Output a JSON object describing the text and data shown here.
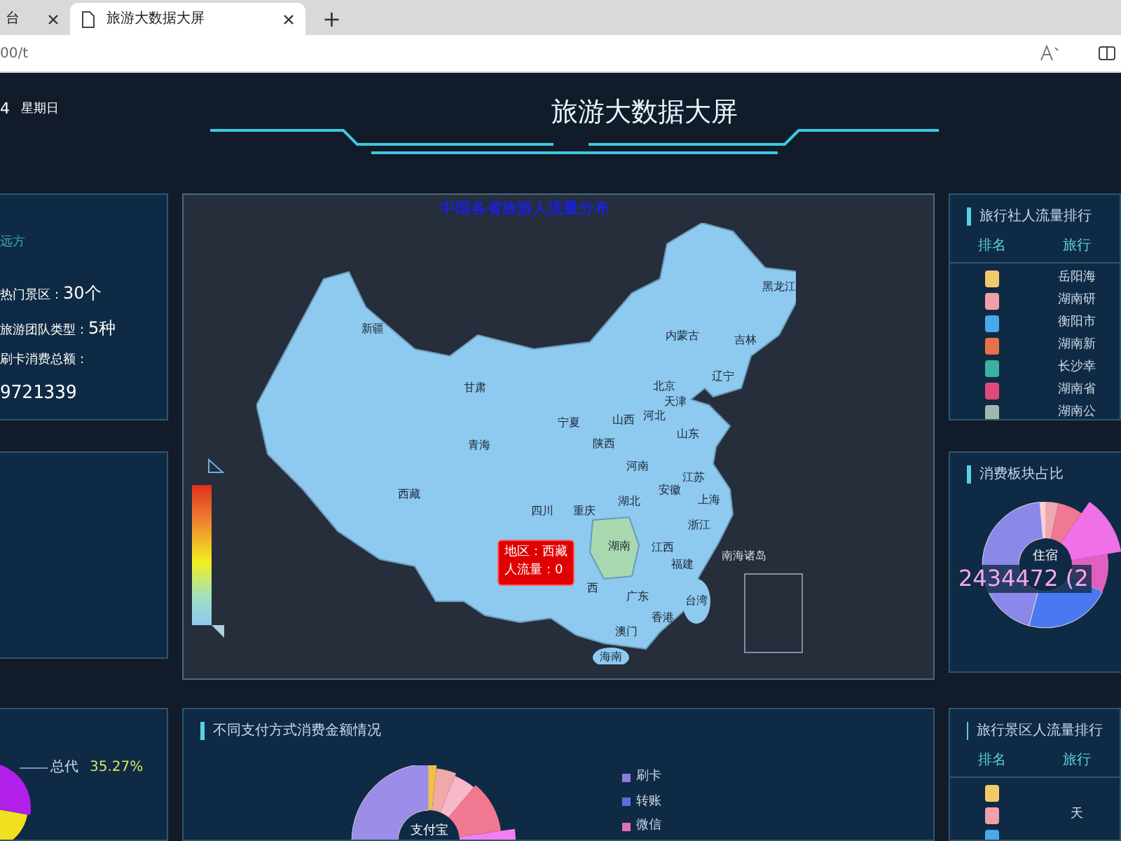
{
  "browser": {
    "tabs": [
      {
        "title": "台",
        "selected": false
      },
      {
        "title": "旅游大数据大屏",
        "selected": true
      }
    ],
    "new_tab": "+",
    "address": "00/t"
  },
  "header": {
    "date": "4",
    "weekday": "星期日",
    "title": "旅游大数据大屏"
  },
  "summary": {
    "heading": "远方",
    "stats": [
      {
        "label": "热门景区：",
        "value": "30个"
      },
      {
        "label": "旅游团队类型：",
        "value": "5种"
      }
    ],
    "total_label": "刷卡消费总额：",
    "total_value": "9721339"
  },
  "age_chart": {
    "label": "总代",
    "percent": "35.27%"
  },
  "map": {
    "title": "中国各省旅游人流量分布",
    "regions": [
      "新疆",
      "甘肃",
      "内蒙古",
      "黑龙江",
      "吉林",
      "辽宁",
      "北京",
      "天津",
      "河北",
      "宁夏",
      "山西",
      "青海",
      "陕西",
      "山东",
      "河南",
      "江苏",
      "安徽",
      "湖北",
      "西藏",
      "四川",
      "重庆",
      "上海",
      "浙江",
      "湖南",
      "江西",
      "福建",
      "西",
      "广东",
      "台湾",
      "香港",
      "澳门",
      "海南",
      "南海诸岛"
    ],
    "tooltip": [
      "地区：西藏",
      "人流量：0"
    ]
  },
  "agency_ranking": {
    "title": "旅行社人流量排行",
    "columns": [
      "排名",
      "旅行"
    ],
    "rows": [
      {
        "color": "#f2c96a",
        "name": "岳阳海"
      },
      {
        "color": "#f0a0a8",
        "name": "湖南研"
      },
      {
        "color": "#4aa8e8",
        "name": "衡阳市"
      },
      {
        "color": "#e8704a",
        "name": "湖南新"
      },
      {
        "color": "#3ab0a0",
        "name": "长沙幸"
      },
      {
        "color": "#e04a7a",
        "name": "湖南省"
      },
      {
        "color": "#a0b8b0",
        "name": "湖南公"
      }
    ]
  },
  "consumption_share": {
    "title": "消费板块占比",
    "center_label": "住宿",
    "value_label": "2434472 (2"
  },
  "payment": {
    "title": "不同支付方式消费金额情况",
    "center_label": "支付宝",
    "legend": [
      {
        "label": "刷卡",
        "color": "#8a7fd8"
      },
      {
        "label": "转账",
        "color": "#5b6fe0"
      },
      {
        "label": "微信",
        "color": "#e070b0"
      }
    ]
  },
  "scenic_ranking": {
    "title": "旅行景区人流量排行",
    "columns": [
      "排名",
      "旅行"
    ],
    "rows": [
      {
        "color": "#f2c96a"
      },
      {
        "color": "#f0a0a8",
        "name": "天"
      },
      {
        "color": "#4aa8e8"
      }
    ]
  }
}
